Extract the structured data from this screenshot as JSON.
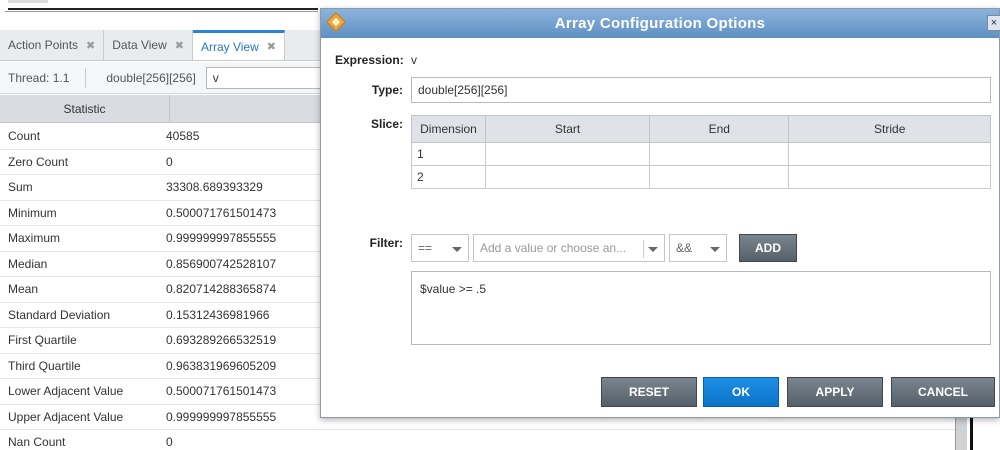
{
  "tabs": [
    {
      "label": "Action Points",
      "close": "✖"
    },
    {
      "label": "Data View",
      "close": "✖"
    },
    {
      "label": "Array View",
      "close": "✖"
    }
  ],
  "threadbar": {
    "thread": "Thread: 1.1",
    "type": "double[256][256]",
    "expression": "v"
  },
  "stats": {
    "header": "Statistic",
    "rows": [
      {
        "name": "Count",
        "value": "40585"
      },
      {
        "name": "Zero Count",
        "value": "0"
      },
      {
        "name": "Sum",
        "value": "33308.689393329"
      },
      {
        "name": "Minimum",
        "value": "0.500071761501473"
      },
      {
        "name": "Maximum",
        "value": "0.999999997855555"
      },
      {
        "name": "Median",
        "value": "0.856900742528107"
      },
      {
        "name": "Mean",
        "value": "0.820714288365874"
      },
      {
        "name": "Standard Deviation",
        "value": "0.15312436981966"
      },
      {
        "name": "First Quartile",
        "value": "0.693289266532519"
      },
      {
        "name": "Third Quartile",
        "value": "0.963831969605209"
      },
      {
        "name": "Lower Adjacent Value",
        "value": "0.500071761501473"
      },
      {
        "name": "Upper Adjacent Value",
        "value": "0.999999997855555"
      },
      {
        "name": "Nan Count",
        "value": "0"
      }
    ]
  },
  "dialog": {
    "title": "Array Configuration Options",
    "close": "×",
    "expression_label": "Expression:",
    "expression_value": "v",
    "type_label": "Type:",
    "type_value": "double[256][256]",
    "slice_label": "Slice:",
    "slice_headers": [
      "Dimension",
      "Start",
      "End",
      "Stride"
    ],
    "slice_rows": [
      {
        "dim": "1"
      },
      {
        "dim": "2"
      }
    ],
    "filter_label": "Filter:",
    "filter_op": "==",
    "filter_value_placeholder": "Add a value or choose an...",
    "filter_logic": "&&",
    "add_label": "ADD",
    "filter_text": "$value >= .5",
    "buttons": {
      "reset": "RESET",
      "ok": "OK",
      "apply": "APPLY",
      "cancel": "CANCEL"
    }
  }
}
